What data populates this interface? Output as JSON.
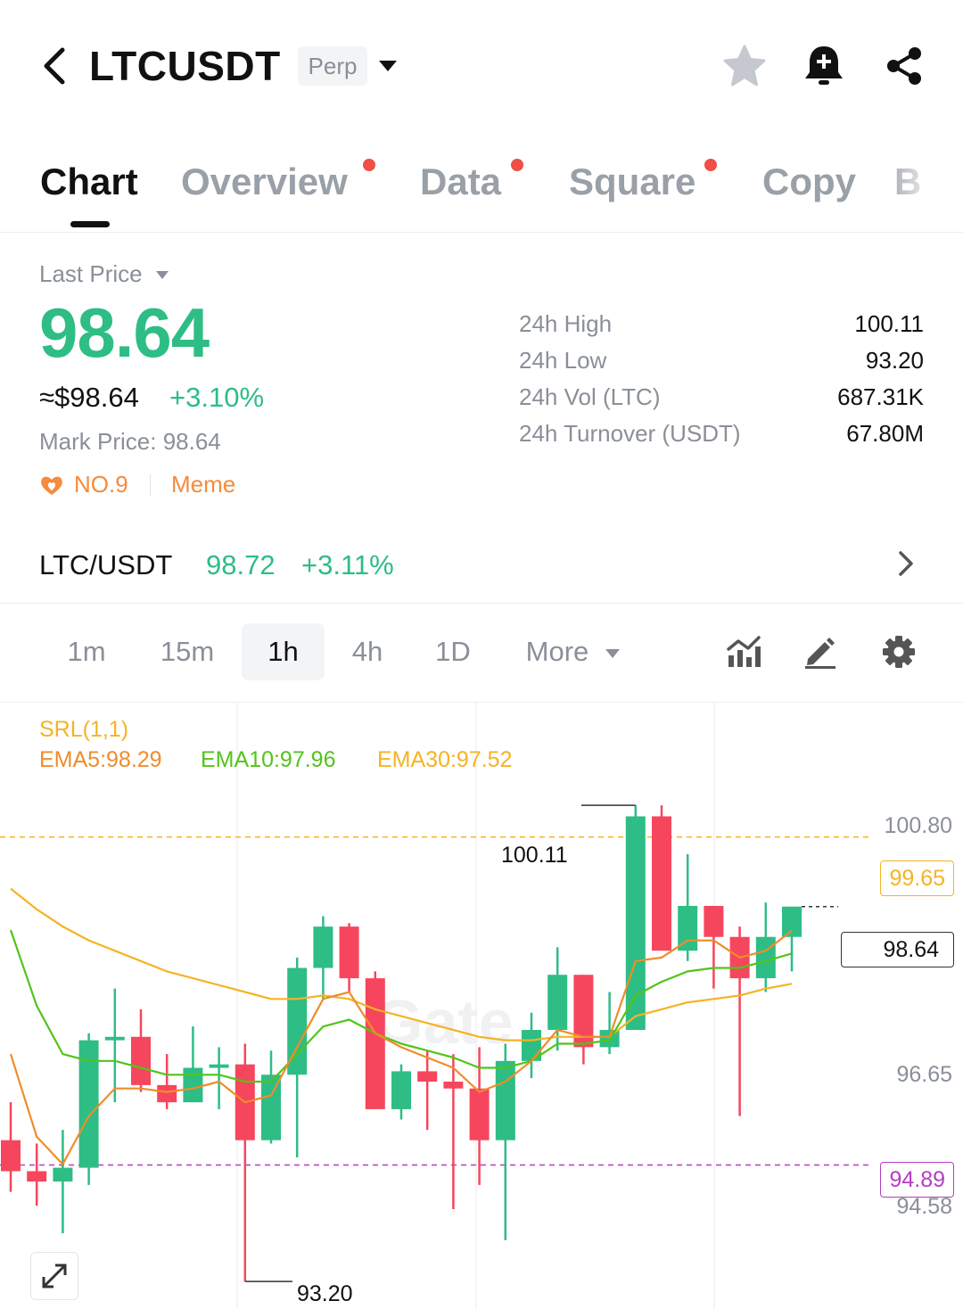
{
  "header": {
    "symbol": "LTCUSDT",
    "contract_type": "Perp",
    "icons": [
      "back-arrow-icon",
      "star-icon",
      "bell-plus-icon",
      "share-icon"
    ]
  },
  "tabs": [
    {
      "label": "Chart",
      "active": true,
      "dot": false
    },
    {
      "label": "Overview",
      "active": false,
      "dot": true
    },
    {
      "label": "Data",
      "active": false,
      "dot": true
    },
    {
      "label": "Square",
      "active": false,
      "dot": true
    },
    {
      "label": "Copy",
      "active": false,
      "dot": false
    },
    {
      "label": "B",
      "active": false,
      "dot": false
    }
  ],
  "price": {
    "last_price_label": "Last Price",
    "last_price": "98.64",
    "usd_value": "≈$98.64",
    "change_pct": "+3.10%",
    "mark_price_label": "Mark Price:",
    "mark_price": "98.64",
    "rank": "NO.9",
    "category": "Meme"
  },
  "stats": [
    {
      "label": "24h High",
      "value": "100.11"
    },
    {
      "label": "24h Low",
      "value": "93.20"
    },
    {
      "label": "24h Vol (LTC)",
      "value": "687.31K"
    },
    {
      "label": "24h Turnover (USDT)",
      "value": "67.80M"
    }
  ],
  "spot": {
    "pair": "LTC/USDT",
    "price": "98.72",
    "change": "+3.11%"
  },
  "intervals": {
    "items": [
      "1m",
      "15m",
      "1h",
      "4h",
      "1D",
      "More"
    ],
    "selected": "1h"
  },
  "indicators": {
    "srl": "SRL(1,1)",
    "ema5": "EMA5:98.29",
    "ema10": "EMA10:97.96",
    "ema30": "EMA30:97.52"
  },
  "colors": {
    "up": "#2ebd85",
    "down": "#f6465d",
    "ema5": "#f08c2a",
    "ema10": "#52c41a",
    "ema30": "#f5b324",
    "srl_high": "#f5b324",
    "srl_low": "#b63ec2"
  },
  "chart_data": {
    "type": "candlestick",
    "y_axis_labels": [
      "100.80",
      "96.65",
      "94.58"
    ],
    "ylim": [
      92.8,
      101.6
    ],
    "high_marker": "100.11",
    "low_marker": "93.20",
    "srl_high_line": "99.65",
    "srl_low_line": "94.89",
    "current_price": "98.64",
    "watermark": "Gate",
    "candles": [
      {
        "o": 95.25,
        "h": 95.8,
        "l": 94.5,
        "c": 94.8
      },
      {
        "o": 94.8,
        "h": 95.2,
        "l": 94.3,
        "c": 94.65
      },
      {
        "o": 94.65,
        "h": 95.4,
        "l": 93.9,
        "c": 94.85
      },
      {
        "o": 94.85,
        "h": 96.8,
        "l": 94.6,
        "c": 96.7
      },
      {
        "o": 96.7,
        "h": 97.45,
        "l": 95.8,
        "c": 96.75
      },
      {
        "o": 96.75,
        "h": 97.15,
        "l": 95.95,
        "c": 96.05
      },
      {
        "o": 96.05,
        "h": 96.5,
        "l": 95.7,
        "c": 95.8
      },
      {
        "o": 95.8,
        "h": 96.9,
        "l": 95.8,
        "c": 96.3
      },
      {
        "o": 96.3,
        "h": 96.6,
        "l": 95.7,
        "c": 96.35
      },
      {
        "o": 96.35,
        "h": 96.65,
        "l": 93.2,
        "c": 95.25
      },
      {
        "o": 95.25,
        "h": 96.55,
        "l": 95.2,
        "c": 96.2
      },
      {
        "o": 96.2,
        "h": 97.9,
        "l": 95.0,
        "c": 97.75
      },
      {
        "o": 97.75,
        "h": 98.5,
        "l": 97.3,
        "c": 98.35
      },
      {
        "o": 98.35,
        "h": 98.4,
        "l": 97.4,
        "c": 97.6
      },
      {
        "o": 97.6,
        "h": 97.7,
        "l": 95.7,
        "c": 95.7
      },
      {
        "o": 95.7,
        "h": 96.35,
        "l": 95.55,
        "c": 96.25
      },
      {
        "o": 96.25,
        "h": 96.55,
        "l": 95.4,
        "c": 96.1
      },
      {
        "o": 96.1,
        "h": 96.5,
        "l": 94.25,
        "c": 96.0
      },
      {
        "o": 96.0,
        "h": 96.6,
        "l": 94.6,
        "c": 95.25
      },
      {
        "o": 95.25,
        "h": 96.65,
        "l": 93.8,
        "c": 96.4
      },
      {
        "o": 96.4,
        "h": 97.1,
        "l": 96.15,
        "c": 96.85
      },
      {
        "o": 96.85,
        "h": 98.05,
        "l": 96.55,
        "c": 97.65
      },
      {
        "o": 97.65,
        "h": 97.65,
        "l": 96.35,
        "c": 96.6
      },
      {
        "o": 96.6,
        "h": 97.4,
        "l": 96.5,
        "c": 96.85
      },
      {
        "o": 96.85,
        "h": 100.11,
        "l": 96.85,
        "c": 99.95
      },
      {
        "o": 99.95,
        "h": 100.11,
        "l": 98.05,
        "c": 98.0
      },
      {
        "o": 98.0,
        "h": 99.4,
        "l": 97.85,
        "c": 98.65
      },
      {
        "o": 98.65,
        "h": 98.65,
        "l": 97.45,
        "c": 98.2
      },
      {
        "o": 98.2,
        "h": 98.35,
        "l": 95.6,
        "c": 97.6
      },
      {
        "o": 97.6,
        "h": 98.7,
        "l": 97.4,
        "c": 98.2
      },
      {
        "o": 98.2,
        "h": 98.64,
        "l": 97.7,
        "c": 98.64
      }
    ],
    "ema5": [
      96.5,
      95.3,
      94.9,
      95.6,
      96.0,
      96.0,
      95.95,
      96.0,
      96.1,
      95.8,
      95.9,
      96.6,
      97.3,
      97.4,
      96.8,
      96.6,
      96.45,
      96.3,
      95.95,
      96.1,
      96.4,
      96.85,
      96.75,
      96.75,
      97.85,
      97.9,
      98.15,
      98.15,
      97.9,
      98.0,
      98.29
    ],
    "ema10": [
      98.3,
      97.2,
      96.5,
      96.4,
      96.4,
      96.3,
      96.2,
      96.2,
      96.2,
      96.1,
      96.1,
      96.5,
      96.9,
      97.0,
      96.8,
      96.65,
      96.55,
      96.45,
      96.3,
      96.3,
      96.4,
      96.65,
      96.65,
      96.7,
      97.35,
      97.55,
      97.7,
      97.75,
      97.75,
      97.85,
      97.96
    ],
    "ema30": [
      98.9,
      98.6,
      98.35,
      98.15,
      98.0,
      97.85,
      97.7,
      97.6,
      97.5,
      97.4,
      97.3,
      97.3,
      97.35,
      97.3,
      97.15,
      97.05,
      96.95,
      96.85,
      96.75,
      96.7,
      96.7,
      96.75,
      96.75,
      96.75,
      97.05,
      97.15,
      97.25,
      97.3,
      97.35,
      97.45,
      97.52
    ]
  }
}
